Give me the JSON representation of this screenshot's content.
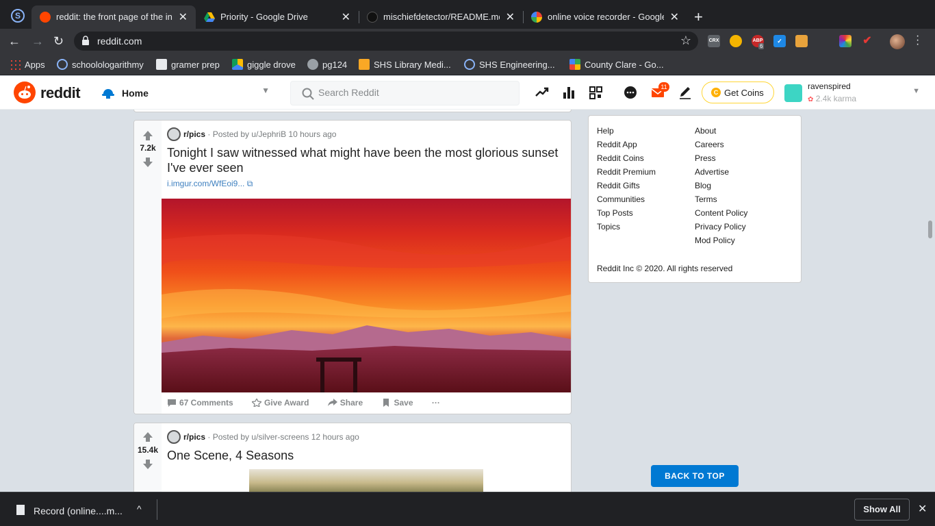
{
  "browser": {
    "tabs": [
      {
        "title": "reddit: the front page of the internet",
        "active": true
      },
      {
        "title": "Priority - Google Drive",
        "active": false
      },
      {
        "title": "mischiefdetector/README.md",
        "active": false
      },
      {
        "title": "online voice recorder - Google",
        "active": false
      }
    ],
    "url": "reddit.com",
    "bookmarks": [
      "Apps",
      "schoolologarithmy",
      "gramer prep",
      "giggle drove",
      "pg124",
      "SHS Library Medi...",
      "SHS Engineering...",
      "County Clare - Go..."
    ],
    "extensions": {
      "abp_count": "6"
    }
  },
  "reddit": {
    "logo_text": "reddit",
    "feed_selector": "Home",
    "search_placeholder": "Search Reddit",
    "mail_badge": "11",
    "coins_label": "Get Coins",
    "username": "ravenspired",
    "karma": "2.4k karma"
  },
  "posts": [
    {
      "subreddit": "r/pics",
      "posted_by": "· Posted by u/JephriB 10 hours ago",
      "score": "7.2k",
      "title": "Tonight I saw witnessed what might have been the most glorious sunset I've ever seen",
      "link": "i.imgur.com/WfEoi9...",
      "comments": "67 Comments",
      "award": "Give Award",
      "share": "Share",
      "save": "Save",
      "more": "···"
    },
    {
      "subreddit": "r/pics",
      "posted_by": "· Posted by u/silver-screens 12 hours ago",
      "score": "15.4k",
      "title": "One Scene, 4 Seasons"
    }
  ],
  "sidebar": {
    "col1": [
      "Help",
      "Reddit App",
      "Reddit Coins",
      "Reddit Premium",
      "Reddit Gifts",
      "Communities",
      "Top Posts",
      "Topics"
    ],
    "col2": [
      "About",
      "Careers",
      "Press",
      "Advertise",
      "Blog",
      "Terms",
      "Content Policy",
      "Privacy Policy",
      "Mod Policy"
    ],
    "copyright": "Reddit Inc © 2020. All rights reserved",
    "back_to_top": "BACK TO TOP"
  },
  "download_bar": {
    "file": "Record (online....m...",
    "show_all": "Show All"
  },
  "colors": {
    "reddit_orange": "#ff4500",
    "reddit_blue": "#0079d3",
    "coin_border": "#ffd635"
  }
}
